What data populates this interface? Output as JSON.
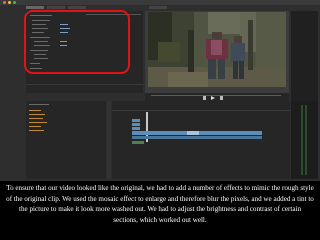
{
  "caption": "To ensure that our video looked like the original, we had to add a number of effects to mimic the rough style of the original clip. We used the mosaic effect to enlarge and therefore blur the pixels, and we added  a tint to the picture to make it look more washed out. We had to adjust the brightness and contrast of certain sections, which worked out well.",
  "colors": {
    "highlight_box": "#e01414",
    "panel_bg": "#262626",
    "app_bg": "#2e2e2e",
    "clip_blue": "#5b8fb9",
    "playhead": "#c8c8c8"
  }
}
